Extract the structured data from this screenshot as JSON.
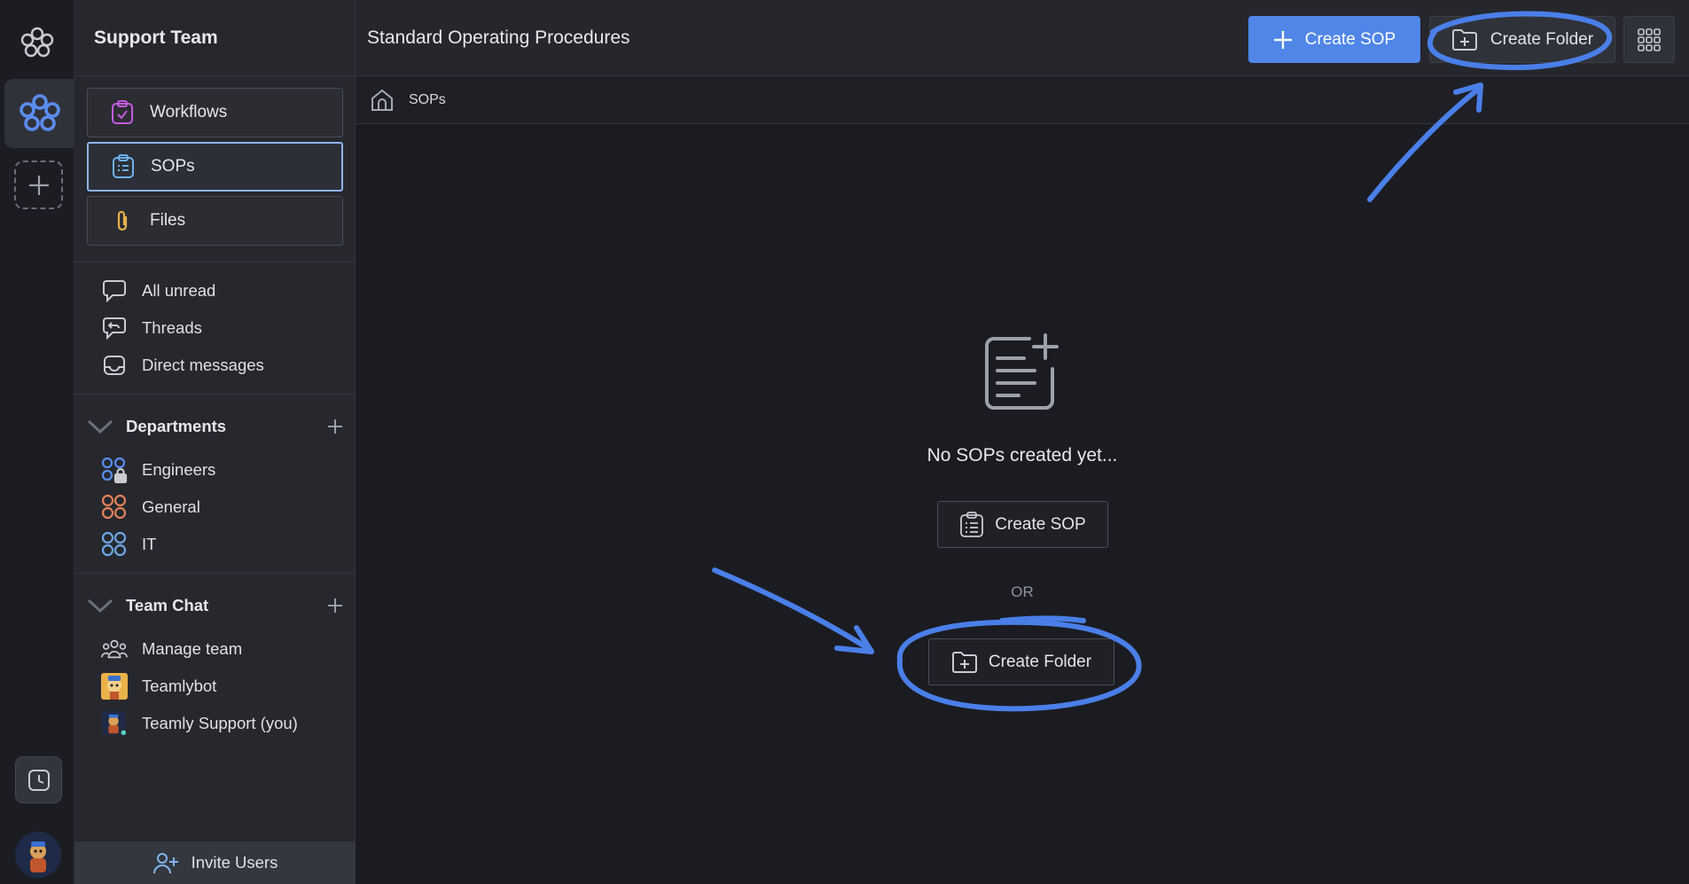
{
  "workspace": {
    "name": "Support Team"
  },
  "nav": [
    {
      "label": "Workflows",
      "icon": "clipboard-check-icon"
    },
    {
      "label": "SOPs",
      "icon": "clipboard-list-icon",
      "active": true
    },
    {
      "label": "Files",
      "icon": "paperclip-icon"
    }
  ],
  "inbox": [
    {
      "label": "All unread",
      "icon": "chat-bubble-icon"
    },
    {
      "label": "Threads",
      "icon": "reply-icon"
    },
    {
      "label": "Direct messages",
      "icon": "inbox-icon"
    }
  ],
  "departments": {
    "title": "Departments",
    "items": [
      {
        "label": "Engineers",
        "icon": "locked-channel-icon",
        "color": "#5b8def"
      },
      {
        "label": "General",
        "icon": "channel-icon",
        "color": "#e2825a"
      },
      {
        "label": "IT",
        "icon": "channel-icon",
        "color": "#6fa8e6"
      }
    ]
  },
  "team_chat": {
    "title": "Team Chat",
    "items": [
      {
        "label": "Manage team",
        "icon": "people-icon"
      },
      {
        "label": "Teamlybot",
        "icon": "bot-avatar"
      },
      {
        "label": "Teamly Support (you)",
        "icon": "user-avatar"
      }
    ]
  },
  "invite": {
    "label": "Invite Users"
  },
  "topbar": {
    "title": "Standard Operating Procedures",
    "create_sop": "Create SOP",
    "create_folder": "Create Folder"
  },
  "breadcrumb": {
    "label": "SOPs"
  },
  "empty_state": {
    "message": "No SOPs created yet...",
    "create_sop": "Create SOP",
    "or": "OR",
    "create_folder": "Create Folder"
  },
  "colors": {
    "accent": "#4f86e8",
    "annotation": "#4a7fe8",
    "active_border": "#8db4f0"
  }
}
